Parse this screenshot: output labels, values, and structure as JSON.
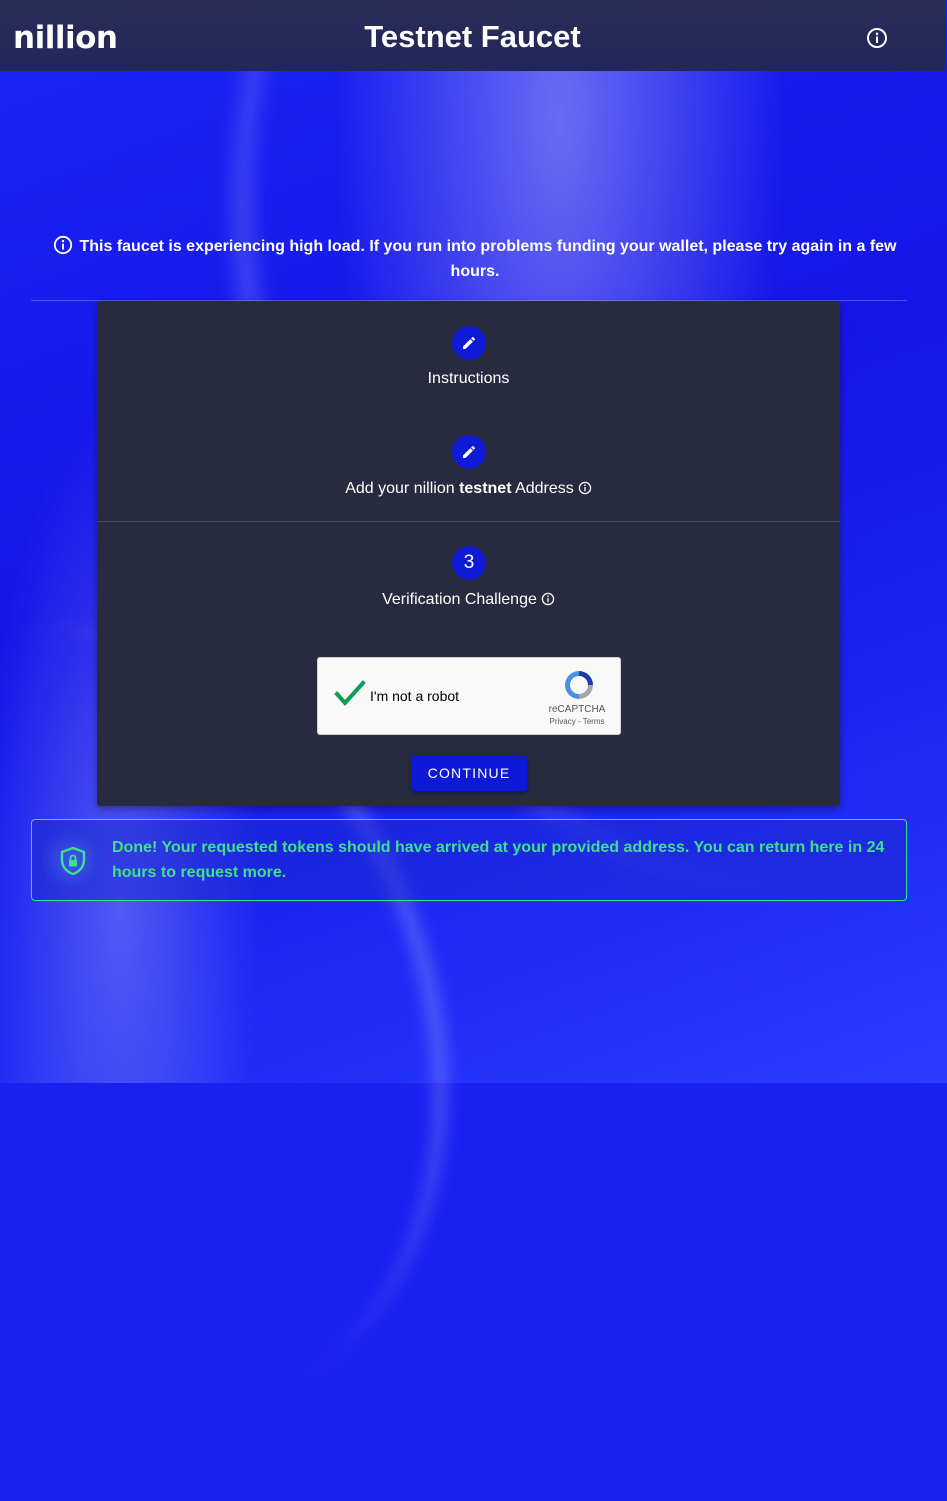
{
  "header": {
    "logo": "nillion",
    "title": "Testnet Faucet",
    "info_icon": "info-icon"
  },
  "notice": {
    "text": "This faucet is experiencing high load. If you run into problems funding your wallet, please try again in a few hours.",
    "icon": "info-icon"
  },
  "steps": [
    {
      "icon": "pencil-icon",
      "label": "Instructions"
    },
    {
      "icon": "pencil-icon",
      "label_prefix": "Add your nillion ",
      "label_bold": "testnet",
      "label_suffix": " Address",
      "info_icon": "info-icon"
    },
    {
      "number": "3",
      "label": "Verification Challenge",
      "info_icon": "info-icon"
    }
  ],
  "captcha": {
    "label": "I'm not a robot",
    "brand": "reCAPTCHA",
    "links": "Privacy - Terms",
    "checked": true
  },
  "continue_button": "CONTINUE",
  "success": {
    "icon": "shield-lock-icon",
    "text": "Done! Your requested tokens should have arrived at your provided address. You can return here in 24 hours to request more."
  },
  "colors": {
    "accent": "#0e19d8",
    "success": "#3de08e",
    "header_bg": "#262a55",
    "card_bg": "#282a3f"
  }
}
